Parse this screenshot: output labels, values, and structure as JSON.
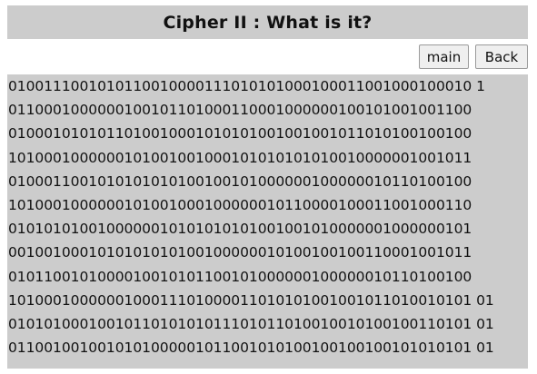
{
  "header": {
    "title": "Cipher II : What is it?"
  },
  "nav": {
    "main_label": "main",
    "back_label": "Back"
  },
  "cipher": {
    "lines": [
      "0100111001010110010000111010101000100011001000100010 1",
      "0110001000000100101101000110001000000100101001001100",
      "0100010101011010010001010101001001001011010100100100",
      "1010001000000101001001000101010101010010000001001011",
      "0100011001010101010100100101000000100000010110100100",
      "1010001000000101001000100000010110000100011001000110",
      "0101010100100000010101010101001001010000001000000101",
      "0010010001010101010100100000010100100100110001001011",
      "0101100101000010010101100101000000100000010110100100",
      "1010001000000100011101000011010101001001011010010101 01",
      "0101010001001011010101011101011010010010100100110101 01",
      "0110010010010101000001011001010100100100100101010101 01"
    ]
  },
  "colors": {
    "panel_bg": "#cccccc",
    "text": "#111111",
    "button_bg": "#efefef",
    "button_border": "#9a9a9a"
  }
}
